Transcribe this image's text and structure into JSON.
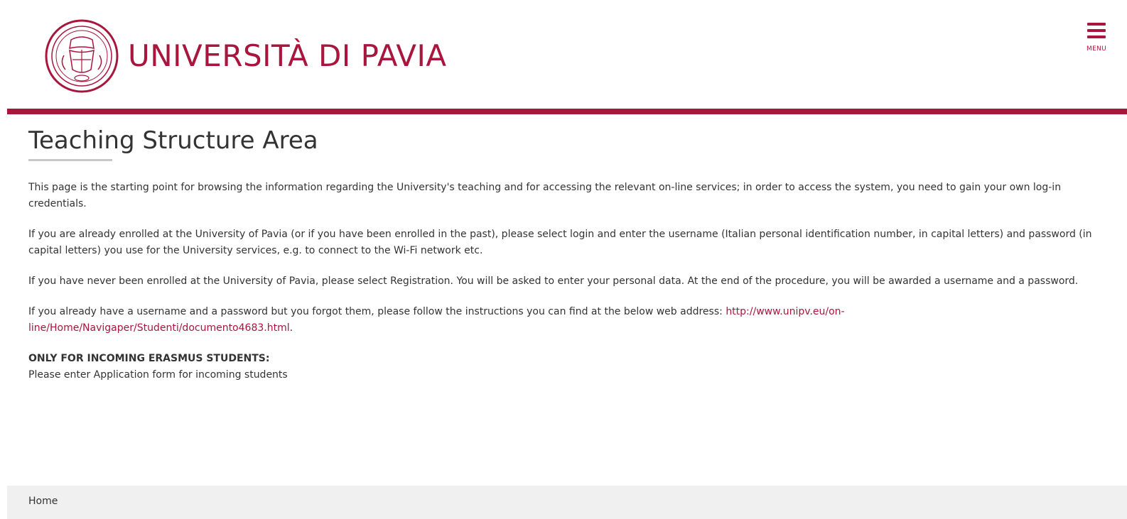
{
  "header": {
    "university_name": "UNIVERSITÀ DI PAVIA",
    "menu_label": "MENU"
  },
  "main": {
    "title": "Teaching Structure Area",
    "paragraphs": [
      "This page is the starting point for browsing the information regarding the University's teaching and for accessing the relevant on-line services; in order to access the system, you need to gain your own log-in credentials.",
      "If you are already enrolled at the University of Pavia (or if you have been enrolled in the past), please select login and enter the username (Italian personal identification number, in capital letters) and password (in capital letters) you use for the University services, e.g. to connect to the Wi-Fi network etc.",
      "If you have never been enrolled at the University of Pavia, please select Registration. You will be asked to enter your personal data. At the end of the procedure, you will be awarded a username and a password."
    ],
    "forgot": {
      "text": "If you already have a username and a password but you forgot them, please follow the instructions you can find at the below web address: ",
      "link": "http://www.unipv.eu/on-line/Home/Navigaper/Studenti/documento4683.html",
      "suffix": "."
    },
    "erasmus": {
      "heading": "ONLY FOR INCOMING ERASMUS STUDENTS:",
      "text": "Please enter Application form for incoming students"
    }
  },
  "footer": {
    "home_label": "Home"
  },
  "colors": {
    "brand": "#a8163d",
    "footer_bg": "#f0f0f0",
    "text": "#333333"
  },
  "icons": {
    "logo": "university-seal-icon",
    "menu": "hamburger-menu-icon"
  }
}
